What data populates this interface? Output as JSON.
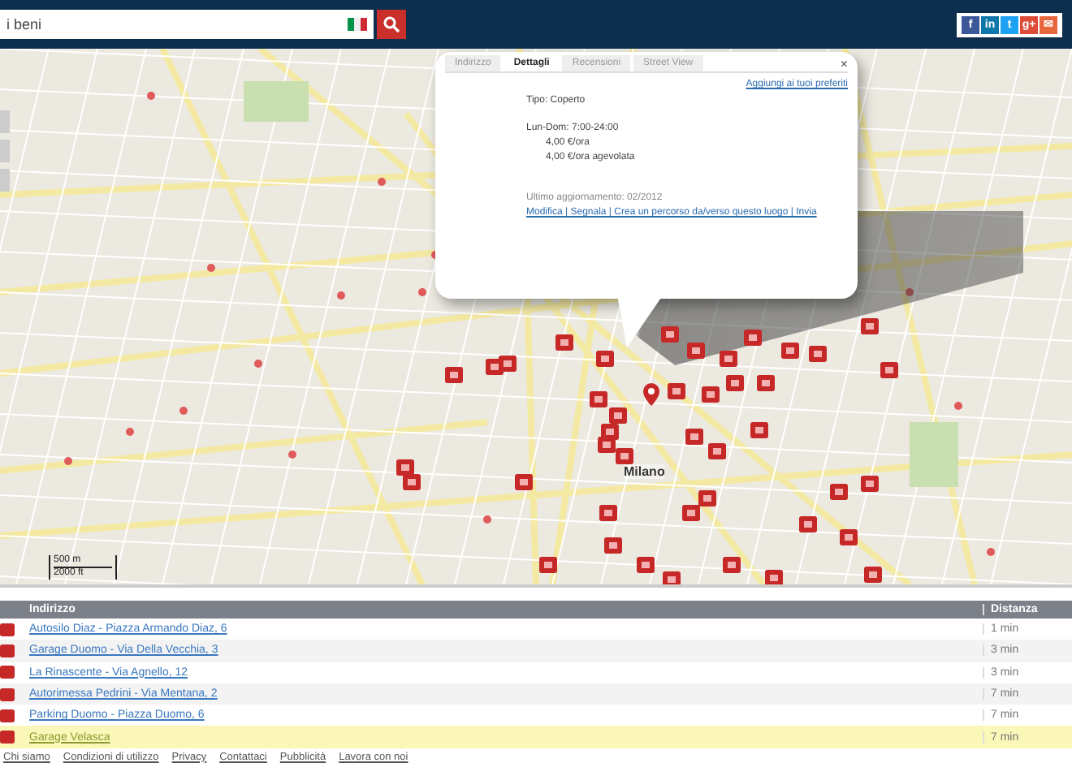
{
  "top_bar": {
    "search": {
      "value": "i beni"
    },
    "share_icons": [
      "f",
      "in",
      "t",
      "g+",
      "✉"
    ]
  },
  "map": {
    "city_label": "Milano",
    "scale": {
      "metric": "500 m",
      "imperial": "2000 ft"
    },
    "popup": {
      "tabs": [
        {
          "label": "Indirizzo",
          "selected": false
        },
        {
          "label": "Dettagli",
          "selected": true
        },
        {
          "label": "Recensioni",
          "selected": false
        },
        {
          "label": "Street View",
          "selected": false
        }
      ],
      "close": "×",
      "favorite_link": "Aggiungi ai tuoi preferiti",
      "lines": [
        {
          "kind": "plain",
          "text": "Tipo: Coperto"
        },
        {
          "kind": "gap"
        },
        {
          "kind": "plain",
          "text": "Lun-Dom:  7:00-24:00"
        },
        {
          "kind": "indent",
          "text": "4,00 €/ora"
        },
        {
          "kind": "indent",
          "text": "4,00 €/ora agevolata"
        },
        {
          "kind": "gap"
        },
        {
          "kind": "gap"
        },
        {
          "kind": "note",
          "text": "Ultimo aggiornamento: 02/2012"
        }
      ],
      "actions": "Modifica | Segnala | Crea un percorso da/verso questo luogo | Invia"
    }
  },
  "table": {
    "columns": [
      "Indirizzo",
      "Distanza"
    ],
    "rows": [
      {
        "name": "Autosilo Diaz - Piazza Armando Diaz, 6",
        "distance": "1 min",
        "selected": false
      },
      {
        "name": "Garage Duomo - Via Della Vecchia, 3",
        "distance": "3 min",
        "selected": false
      },
      {
        "name": "La Rinascente - Via Agnello, 12",
        "distance": "3 min",
        "selected": false
      },
      {
        "name": "Autorimessa Pedrini - Via Mentana, 2",
        "distance": "7 min",
        "selected": false
      },
      {
        "name": "Parking Duomo - Piazza Duomo, 6",
        "distance": "7 min",
        "selected": false
      },
      {
        "name": "Garage Velasca",
        "distance": "7 min",
        "selected": true
      }
    ]
  },
  "footer_links": [
    "Chi siamo",
    "Condizioni di utilizzo",
    "Privacy",
    "Contattaci",
    "Pubblicità",
    "Lavora con noi"
  ]
}
